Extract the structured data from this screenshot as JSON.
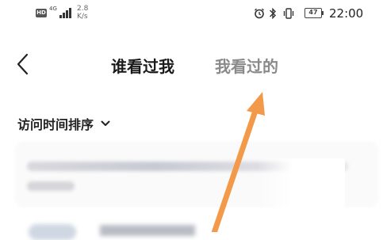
{
  "status_bar": {
    "hd_badge": "HD",
    "network_type": "4G",
    "speed_value": "2.8",
    "speed_unit": "K/s",
    "battery_level": "47",
    "time": "22:00"
  },
  "header": {
    "tabs": [
      {
        "label": "谁看过我",
        "active": true
      },
      {
        "label": "我看过的",
        "active": false
      }
    ]
  },
  "sort": {
    "label": "访问时间排序"
  },
  "colors": {
    "arrow": "#F39A4A",
    "inactive_tab": "#8a8a8a"
  }
}
